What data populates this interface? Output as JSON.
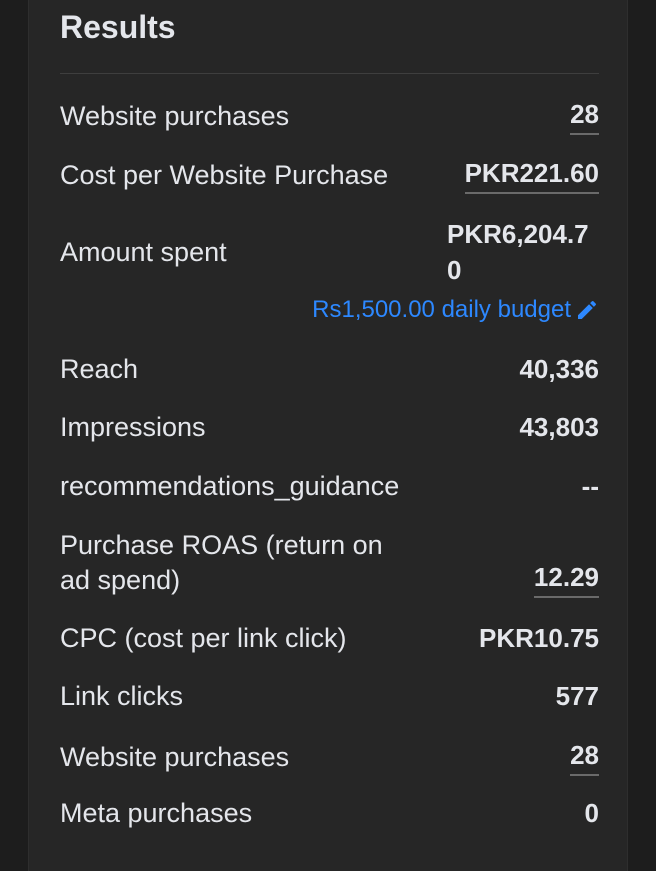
{
  "results": {
    "title": "Results",
    "budget_text": "Rs1,500.00 daily budget",
    "rows": [
      {
        "label": "Website purchases",
        "value": "28"
      },
      {
        "label": "Cost per Website Purchase",
        "value": "PKR221.60"
      },
      {
        "label": "Amount spent",
        "value": "PKR6,204.70"
      },
      {
        "label": "Reach",
        "value": "40,336"
      },
      {
        "label": "Impressions",
        "value": "43,803"
      },
      {
        "label": "recommendations_guidance",
        "value": "--"
      },
      {
        "label_line1": "Purchase ROAS (return on",
        "label_line2": "ad spend)",
        "value": "12.29"
      },
      {
        "label": "CPC (cost per link click)",
        "value": "PKR10.75"
      },
      {
        "label": "Link clicks",
        "value": "577"
      },
      {
        "label": "Website purchases",
        "value": "28"
      },
      {
        "label": "Meta purchases",
        "value": "0"
      }
    ]
  },
  "colors": {
    "background": "#1d1d1d",
    "panel": "#262626",
    "text": "#e4e6eb",
    "link": "#2d88ff",
    "underline": "#6a6a6a"
  },
  "icons": {
    "budget_edit": "pencil-icon"
  }
}
